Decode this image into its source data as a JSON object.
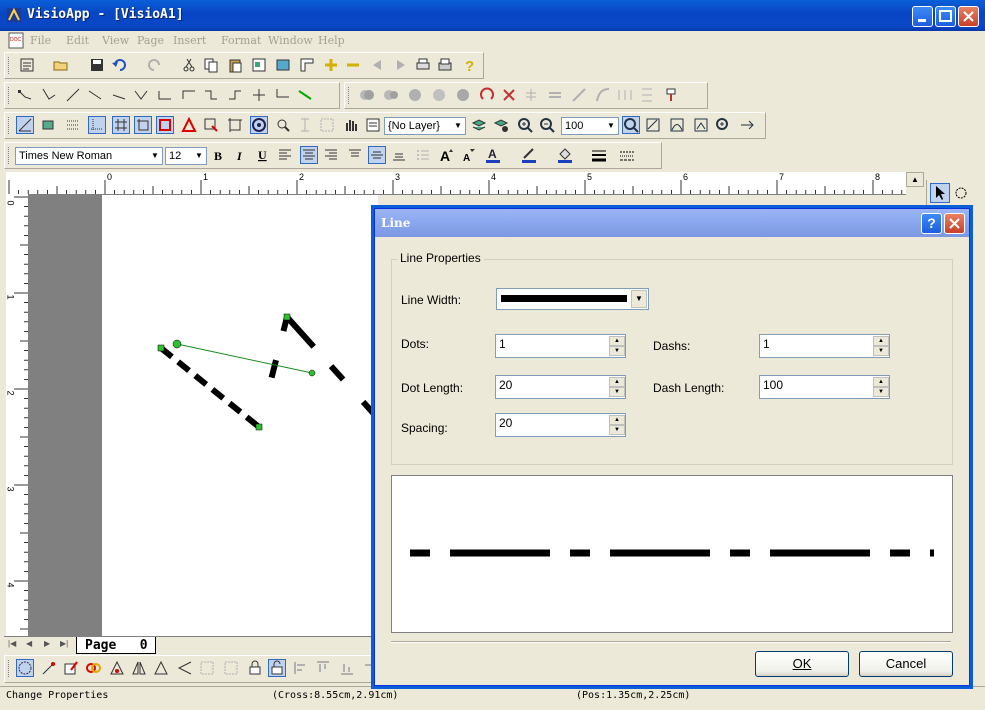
{
  "window": {
    "title": "VisioApp - [VisioA1]"
  },
  "menu": {
    "items": [
      "File",
      "Edit",
      "View",
      "Page",
      "Insert",
      "Format",
      "Window",
      "Help"
    ]
  },
  "toolbar": {
    "layer_value": "{No Layer}",
    "zoom_value": "100",
    "font_name": "Times New Roman",
    "font_size": "12"
  },
  "ruler": {
    "h_labels": [
      "0",
      "1",
      "2",
      "3",
      "4",
      "5",
      "6",
      "7",
      "8"
    ],
    "v_labels": [
      "0",
      "1",
      "2",
      "3",
      "4"
    ]
  },
  "page_tab": {
    "label": "Page   0"
  },
  "status": {
    "left": "Change Properties",
    "cross": "(Cross:8.55cm,2.91cm)",
    "pos": "(Pos:1.35cm,2.25cm)"
  },
  "dialog": {
    "title": "Line",
    "group_label": "Line Properties",
    "line_width_label": "Line Width:",
    "dots_label": "Dots:",
    "dots_value": "1",
    "dashs_label": "Dashs:",
    "dashs_value": "1",
    "dot_length_label": "Dot Length:",
    "dot_length_value": "20",
    "dash_length_label": "Dash Length:",
    "dash_length_value": "100",
    "spacing_label": "Spacing:",
    "spacing_value": "20",
    "ok_label": "OK",
    "cancel_label": "Cancel"
  },
  "colors": {
    "titlebar": "#0a47c6",
    "dialog_titlebar": "#8aa6ec",
    "face": "#ece9d8"
  }
}
